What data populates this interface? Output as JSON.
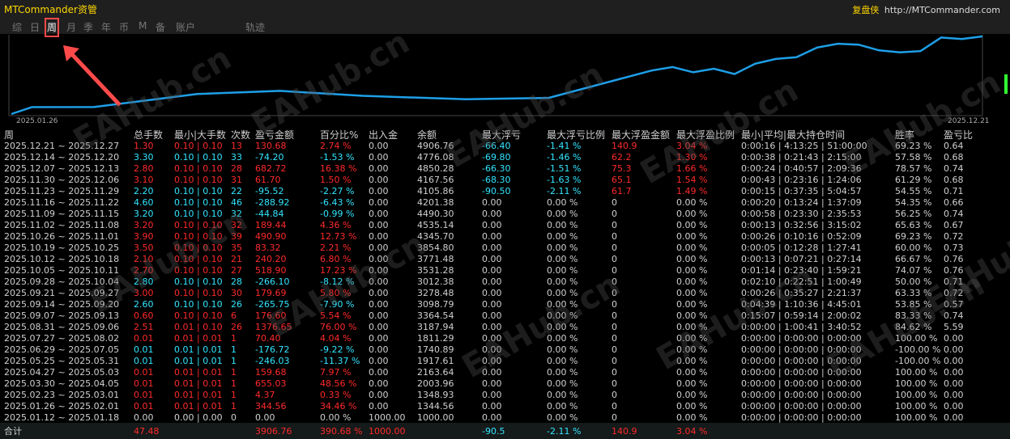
{
  "app": {
    "title": "MTCommander资管",
    "brand_name": "复盘侠",
    "brand_url": "http://MTCommander.com"
  },
  "tabs": [
    "综",
    "日",
    "周",
    "月",
    "季",
    "年",
    "币",
    "M",
    "备",
    "账户",
    "轨迹"
  ],
  "active_tab": "周",
  "chart": {
    "start_label": "2025.01.26",
    "end_label": "2025.12.21",
    "line_color": "#1e9fe8"
  },
  "chart_data": {
    "type": "line",
    "x": [
      "2025.01.26",
      "2025.02.02",
      "2025.02.23",
      "2025.03.30",
      "2025.04.27",
      "2025.05.25",
      "2025.06.29",
      "2025.07.27",
      "2025.08.31",
      "2025.09.07",
      "2025.09.14",
      "2025.09.21",
      "2025.09.28",
      "2025.10.05",
      "2025.10.12",
      "2025.10.19",
      "2025.10.26",
      "2025.11.02",
      "2025.11.09",
      "2025.11.16",
      "2025.11.23",
      "2025.11.30",
      "2025.12.07",
      "2025.12.14",
      "2025.12.21"
    ],
    "values": [
      1000.0,
      1344.56,
      1348.93,
      2003.96,
      2163.64,
      1917.61,
      1740.89,
      1811.29,
      3187.94,
      3364.54,
      3098.79,
      3278.48,
      3012.38,
      3531.28,
      3771.48,
      3854.8,
      4345.7,
      4535.14,
      4490.3,
      4201.38,
      4105.86,
      4167.56,
      4850.28,
      4776.08,
      4906.76
    ]
  },
  "table": {
    "columns": [
      "周",
      "总手数",
      "最小|大手数",
      "次数",
      "盈亏金额",
      "百分比%",
      "出入金",
      "余额",
      "最大浮亏",
      "最大浮亏比例",
      "最大浮盈金额",
      "最大浮盈比例",
      "最小|平均|最大持仓时间",
      "胜率",
      "盈亏比"
    ],
    "rows": [
      [
        "2025.12.21 ~ 2025.12.27",
        "1.30",
        "0.10 | 0.10",
        "13",
        "130.68",
        "2.74 %",
        "0.00",
        "4906.76",
        "-66.40",
        "-1.41 %",
        "140.9",
        "3.04 %",
        "0:00:16 | 4:13:25 | 51:00:00",
        "69.23 %",
        "0.64"
      ],
      [
        "2025.12.14 ~ 2025.12.20",
        "3.30",
        "0.10 | 0.10",
        "33",
        "-74.20",
        "-1.53 %",
        "0.00",
        "4776.08",
        "-69.80",
        "-1.46 %",
        "62.2",
        "1.30 %",
        "0:00:38 | 0:21:43 | 2:15:00",
        "57.58 %",
        "0.68"
      ],
      [
        "2025.12.07 ~ 2025.12.13",
        "2.80",
        "0.10 | 0.10",
        "28",
        "682.72",
        "16.38 %",
        "0.00",
        "4850.28",
        "-66.30",
        "-1.51 %",
        "75.3",
        "1.66 %",
        "0:00:24 | 0:40:57 | 2:09:36",
        "78.57 %",
        "0.74"
      ],
      [
        "2025.11.30 ~ 2025.12.06",
        "3.10",
        "0.10 | 0.10",
        "31",
        "61.70",
        "1.50 %",
        "0.00",
        "4167.56",
        "-68.30",
        "-1.63 %",
        "65.1",
        "1.54 %",
        "0:00:43 | 0:23:16 | 1:24:06",
        "61.29 %",
        "0.68"
      ],
      [
        "2025.11.23 ~ 2025.11.29",
        "2.20",
        "0.10 | 0.10",
        "22",
        "-95.52",
        "-2.27 %",
        "0.00",
        "4105.86",
        "-90.50",
        "-2.11 %",
        "61.7",
        "1.49 %",
        "0:00:15 | 0:37:35 | 5:04:57",
        "54.55 %",
        "0.71"
      ],
      [
        "2025.11.16 ~ 2025.11.22",
        "4.60",
        "0.10 | 0.10",
        "46",
        "-288.92",
        "-6.43 %",
        "0.00",
        "4201.38",
        "0.00",
        "0.00 %",
        "0",
        "0.00 %",
        "0:00:20 | 0:13:24 | 1:37:09",
        "54.35 %",
        "0.66"
      ],
      [
        "2025.11.09 ~ 2025.11.15",
        "3.20",
        "0.10 | 0.10",
        "32",
        "-44.84",
        "-0.99 %",
        "0.00",
        "4490.30",
        "0.00",
        "0.00 %",
        "0",
        "0.00 %",
        "0:00:58 | 0:23:30 | 2:35:53",
        "56.25 %",
        "0.74"
      ],
      [
        "2025.11.02 ~ 2025.11.08",
        "3.20",
        "0.10 | 0.10",
        "32",
        "189.44",
        "4.36 %",
        "0.00",
        "4535.14",
        "0.00",
        "0.00 %",
        "0",
        "0.00 %",
        "0:00:13 | 0:32:56 | 3:15:02",
        "65.63 %",
        "0.67"
      ],
      [
        "2025.10.26 ~ 2025.11.01",
        "3.90",
        "0.10 | 0.10",
        "39",
        "490.90",
        "12.73 %",
        "0.00",
        "4345.70",
        "0.00",
        "0.00 %",
        "0",
        "0.00 %",
        "0:00:26 | 0:10:16 | 0:52:09",
        "69.23 %",
        "0.72"
      ],
      [
        "2025.10.19 ~ 2025.10.25",
        "3.50",
        "0.10 | 0.10",
        "35",
        "83.32",
        "2.21 %",
        "0.00",
        "3854.80",
        "0.00",
        "0.00 %",
        "0",
        "0.00 %",
        "0:00:05 | 0:12:28 | 1:27:41",
        "60.00 %",
        "0.73"
      ],
      [
        "2025.10.12 ~ 2025.10.18",
        "2.10",
        "0.10 | 0.10",
        "21",
        "240.20",
        "6.80 %",
        "0.00",
        "3771.48",
        "0.00",
        "0.00 %",
        "0",
        "0.00 %",
        "0:00:13 | 0:07:21 | 0:27:14",
        "66.67 %",
        "0.76"
      ],
      [
        "2025.10.05 ~ 2025.10.11",
        "2.70",
        "0.10 | 0.10",
        "27",
        "518.90",
        "17.23 %",
        "0.00",
        "3531.28",
        "0.00",
        "0.00 %",
        "0",
        "0.00 %",
        "0:01:14 | 0:23:40 | 1:59:21",
        "74.07 %",
        "0.76"
      ],
      [
        "2025.09.28 ~ 2025.10.04",
        "2.80",
        "0.10 | 0.10",
        "28",
        "-266.10",
        "-8.12 %",
        "0.00",
        "3012.38",
        "0.00",
        "0.00 %",
        "0",
        "0.00 %",
        "0:02:10 | 0:22:51 | 1:00:49",
        "50.00 %",
        "0.71"
      ],
      [
        "2025.09.21 ~ 2025.09.27",
        "3.00",
        "0.10 | 0.10",
        "30",
        "179.69",
        "5.80 %",
        "0.00",
        "3278.48",
        "0.00",
        "0.00 %",
        "0",
        "0.00 %",
        "0:00:26 | 0:35:27 | 2:21:37",
        "63.33 %",
        "0.72"
      ],
      [
        "2025.09.14 ~ 2025.09.20",
        "2.60",
        "0.10 | 0.10",
        "26",
        "-265.75",
        "-7.90 %",
        "0.00",
        "3098.79",
        "0.00",
        "0.00 %",
        "0",
        "0.00 %",
        "0:04:39 | 1:10:36 | 4:45:01",
        "53.85 %",
        "0.57"
      ],
      [
        "2025.09.07 ~ 2025.09.13",
        "0.60",
        "0.10 | 0.10",
        "6",
        "176.60",
        "5.54 %",
        "0.00",
        "3364.54",
        "0.00",
        "0.00 %",
        "0",
        "0.00 %",
        "0:15:07 | 0:59:14 | 2:00:02",
        "83.33 %",
        "0.74"
      ],
      [
        "2025.08.31 ~ 2025.09.06",
        "2.51",
        "0.01 | 0.10",
        "26",
        "1376.65",
        "76.00 %",
        "0.00",
        "3187.94",
        "0.00",
        "0.00 %",
        "0",
        "0.00 %",
        "0:00:00 | 1:00:41 | 3:40:52",
        "84.62 %",
        "5.59"
      ],
      [
        "2025.07.27 ~ 2025.08.02",
        "0.01",
        "0.01 | 0.01",
        "1",
        "70.40",
        "4.04 %",
        "0.00",
        "1811.29",
        "0.00",
        "0.00 %",
        "0",
        "0.00 %",
        "0:00:00 | 0:00:00 | 0:00:00",
        "100.00 %",
        "0.00"
      ],
      [
        "2025.06.29 ~ 2025.07.05",
        "0.01",
        "0.01 | 0.01",
        "1",
        "-176.72",
        "-9.22 %",
        "0.00",
        "1740.89",
        "0.00",
        "0.00 %",
        "0",
        "0.00 %",
        "0:00:00 | 0:00:00 | 0:00:00",
        "-100.00 %",
        "0.00"
      ],
      [
        "2025.05.25 ~ 2025.05.31",
        "0.01",
        "0.01 | 0.01",
        "1",
        "-246.03",
        "-11.37 %",
        "0.00",
        "1917.61",
        "0.00",
        "0.00 %",
        "0",
        "0.00 %",
        "0:00:00 | 0:00:00 | 0:00:00",
        "-100.00 %",
        "0.00"
      ],
      [
        "2025.04.27 ~ 2025.05.03",
        "0.01",
        "0.01 | 0.01",
        "1",
        "159.68",
        "7.97 %",
        "0.00",
        "2163.64",
        "0.00",
        "0.00 %",
        "0",
        "0.00 %",
        "0:00:00 | 0:00:00 | 0:00:00",
        "100.00 %",
        "0.00"
      ],
      [
        "2025.03.30 ~ 2025.04.05",
        "0.01",
        "0.01 | 0.01",
        "1",
        "655.03",
        "48.56 %",
        "0.00",
        "2003.96",
        "0.00",
        "0.00 %",
        "0",
        "0.00 %",
        "0:00:00 | 0:00:00 | 0:00:00",
        "100.00 %",
        "0.00"
      ],
      [
        "2025.02.23 ~ 2025.03.01",
        "0.01",
        "0.01 | 0.01",
        "1",
        "4.37",
        "0.33 %",
        "0.00",
        "1348.93",
        "0.00",
        "0.00 %",
        "0",
        "0.00 %",
        "0:00:00 | 0:00:00 | 0:00:00",
        "100.00 %",
        "0.00"
      ],
      [
        "2025.01.26 ~ 2025.02.01",
        "0.01",
        "0.01 | 0.01",
        "1",
        "344.56",
        "34.46 %",
        "0.00",
        "1344.56",
        "0.00",
        "0.00 %",
        "0",
        "0.00 %",
        "0:00:00 | 0:00:00 | 0:00:00",
        "100.00 %",
        "0.00"
      ],
      [
        "2025.01.12 ~ 2025.01.18",
        "0.00",
        "0.00 | 0.00",
        "0",
        "0.00",
        "0.00 %",
        "1000.00",
        "1000.00",
        "0.00",
        "0.00 %",
        "0",
        "0.00 %",
        "0:00:00 | 0:00:00 | 0:00:00",
        "100.00 %",
        "0.00"
      ]
    ],
    "totals": [
      "合计",
      "47.48",
      "",
      "",
      "3906.76",
      "390.68 %",
      "1000.00",
      "",
      "-90.5",
      "-2.11 %",
      "140.9",
      "3.04 %",
      "",
      "",
      ""
    ]
  },
  "watermark_text": "EAHub.cn",
  "colors": {
    "profit": "#ff2a2a",
    "loss": "#32e6ff",
    "neutral": "#d0d0d0",
    "header": "#cfcfcf"
  }
}
